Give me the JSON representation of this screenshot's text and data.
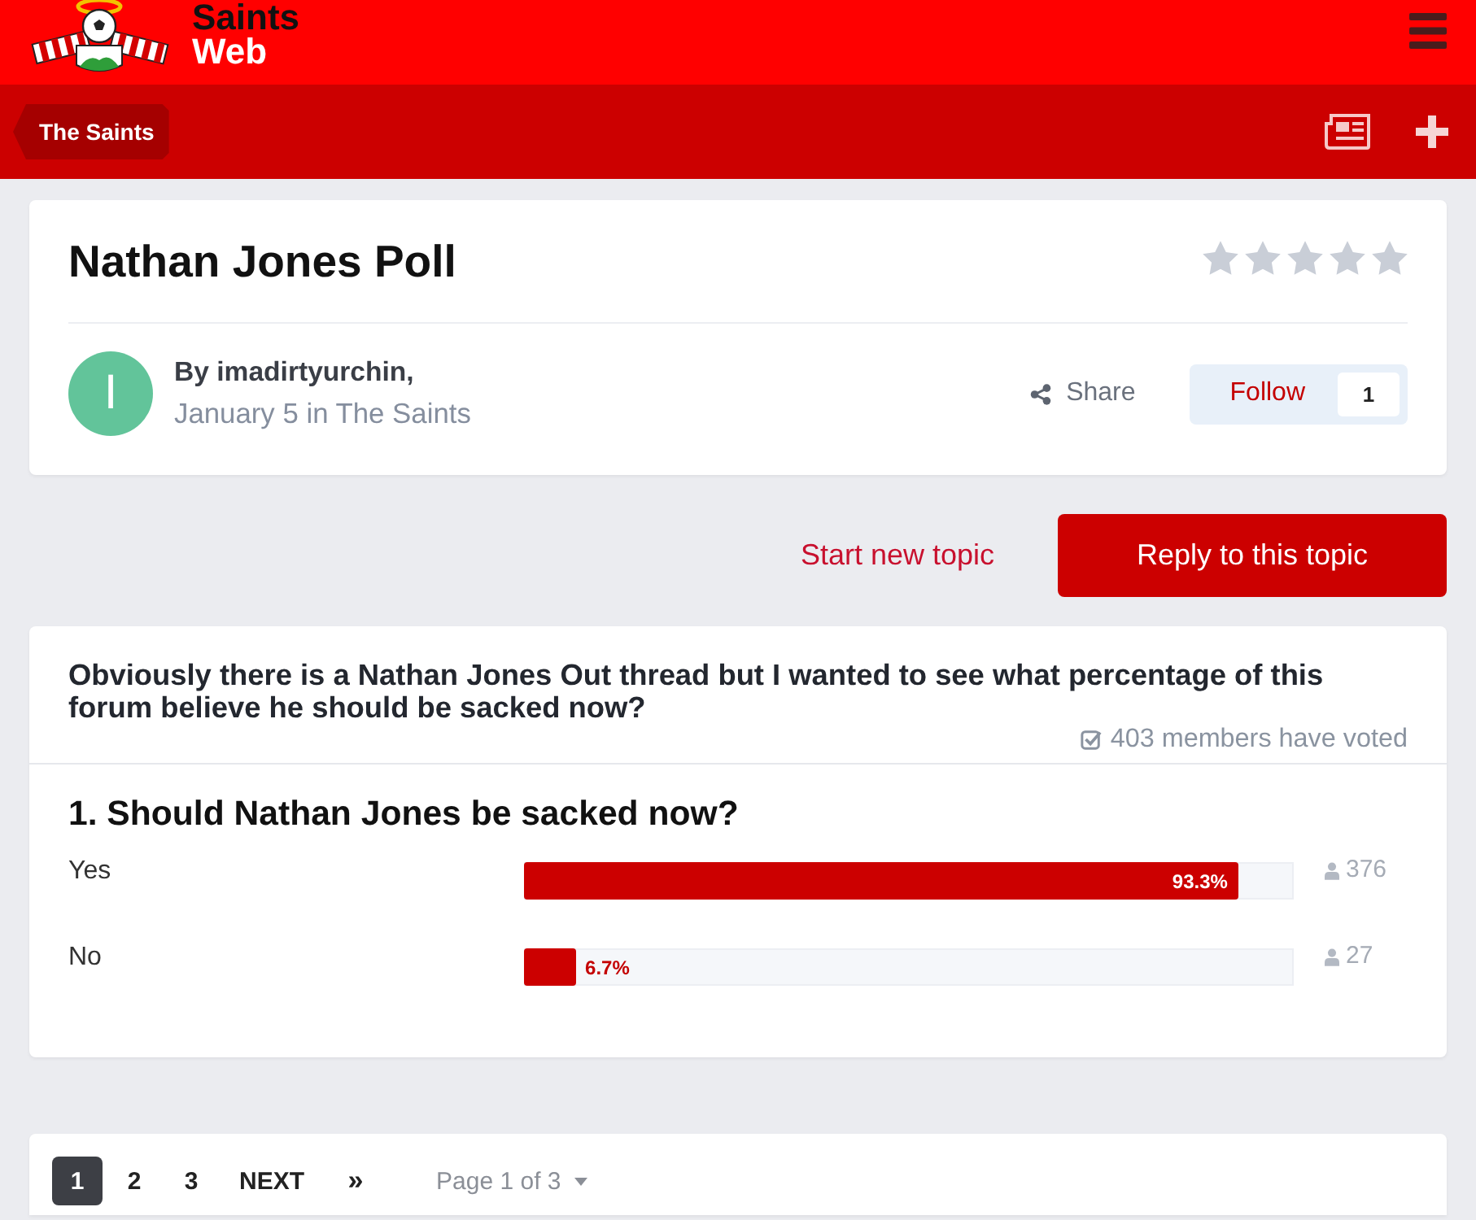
{
  "header": {
    "brand_line1": "Saints",
    "brand_line2": "Web"
  },
  "breadcrumb": {
    "label": "The Saints"
  },
  "topic": {
    "title": "Nathan Jones Poll",
    "stars": 0,
    "avatar_letter": "I",
    "author": "By imadirtyurchin,",
    "meta": "January 5 in The Saints",
    "share": "Share",
    "follow": {
      "label": "Follow",
      "count": "1"
    }
  },
  "actions": {
    "start_topic": "Start new topic",
    "reply": "Reply to this topic"
  },
  "poll": {
    "description": "Obviously there is a Nathan Jones Out thread but I wanted to see what percentage of this forum believe he should be sacked now?",
    "votes": "403 members have voted",
    "questions": [
      {
        "title": "1. Should Nathan Jones be sacked now?",
        "options": [
          {
            "label": "Yes",
            "level": 0.933,
            "percent": "93.3%",
            "votes": "376"
          },
          {
            "label": "No",
            "level": 0.067,
            "percent": "6.7%",
            "votes": "27"
          }
        ]
      }
    ]
  },
  "pagination": {
    "pages": [
      {
        "label": "1",
        "selected": true
      },
      {
        "label": "2",
        "selected": false
      },
      {
        "label": "3",
        "selected": false
      }
    ],
    "next": "NEXT",
    "last": "»",
    "jump": "Page 1 of 3"
  }
}
